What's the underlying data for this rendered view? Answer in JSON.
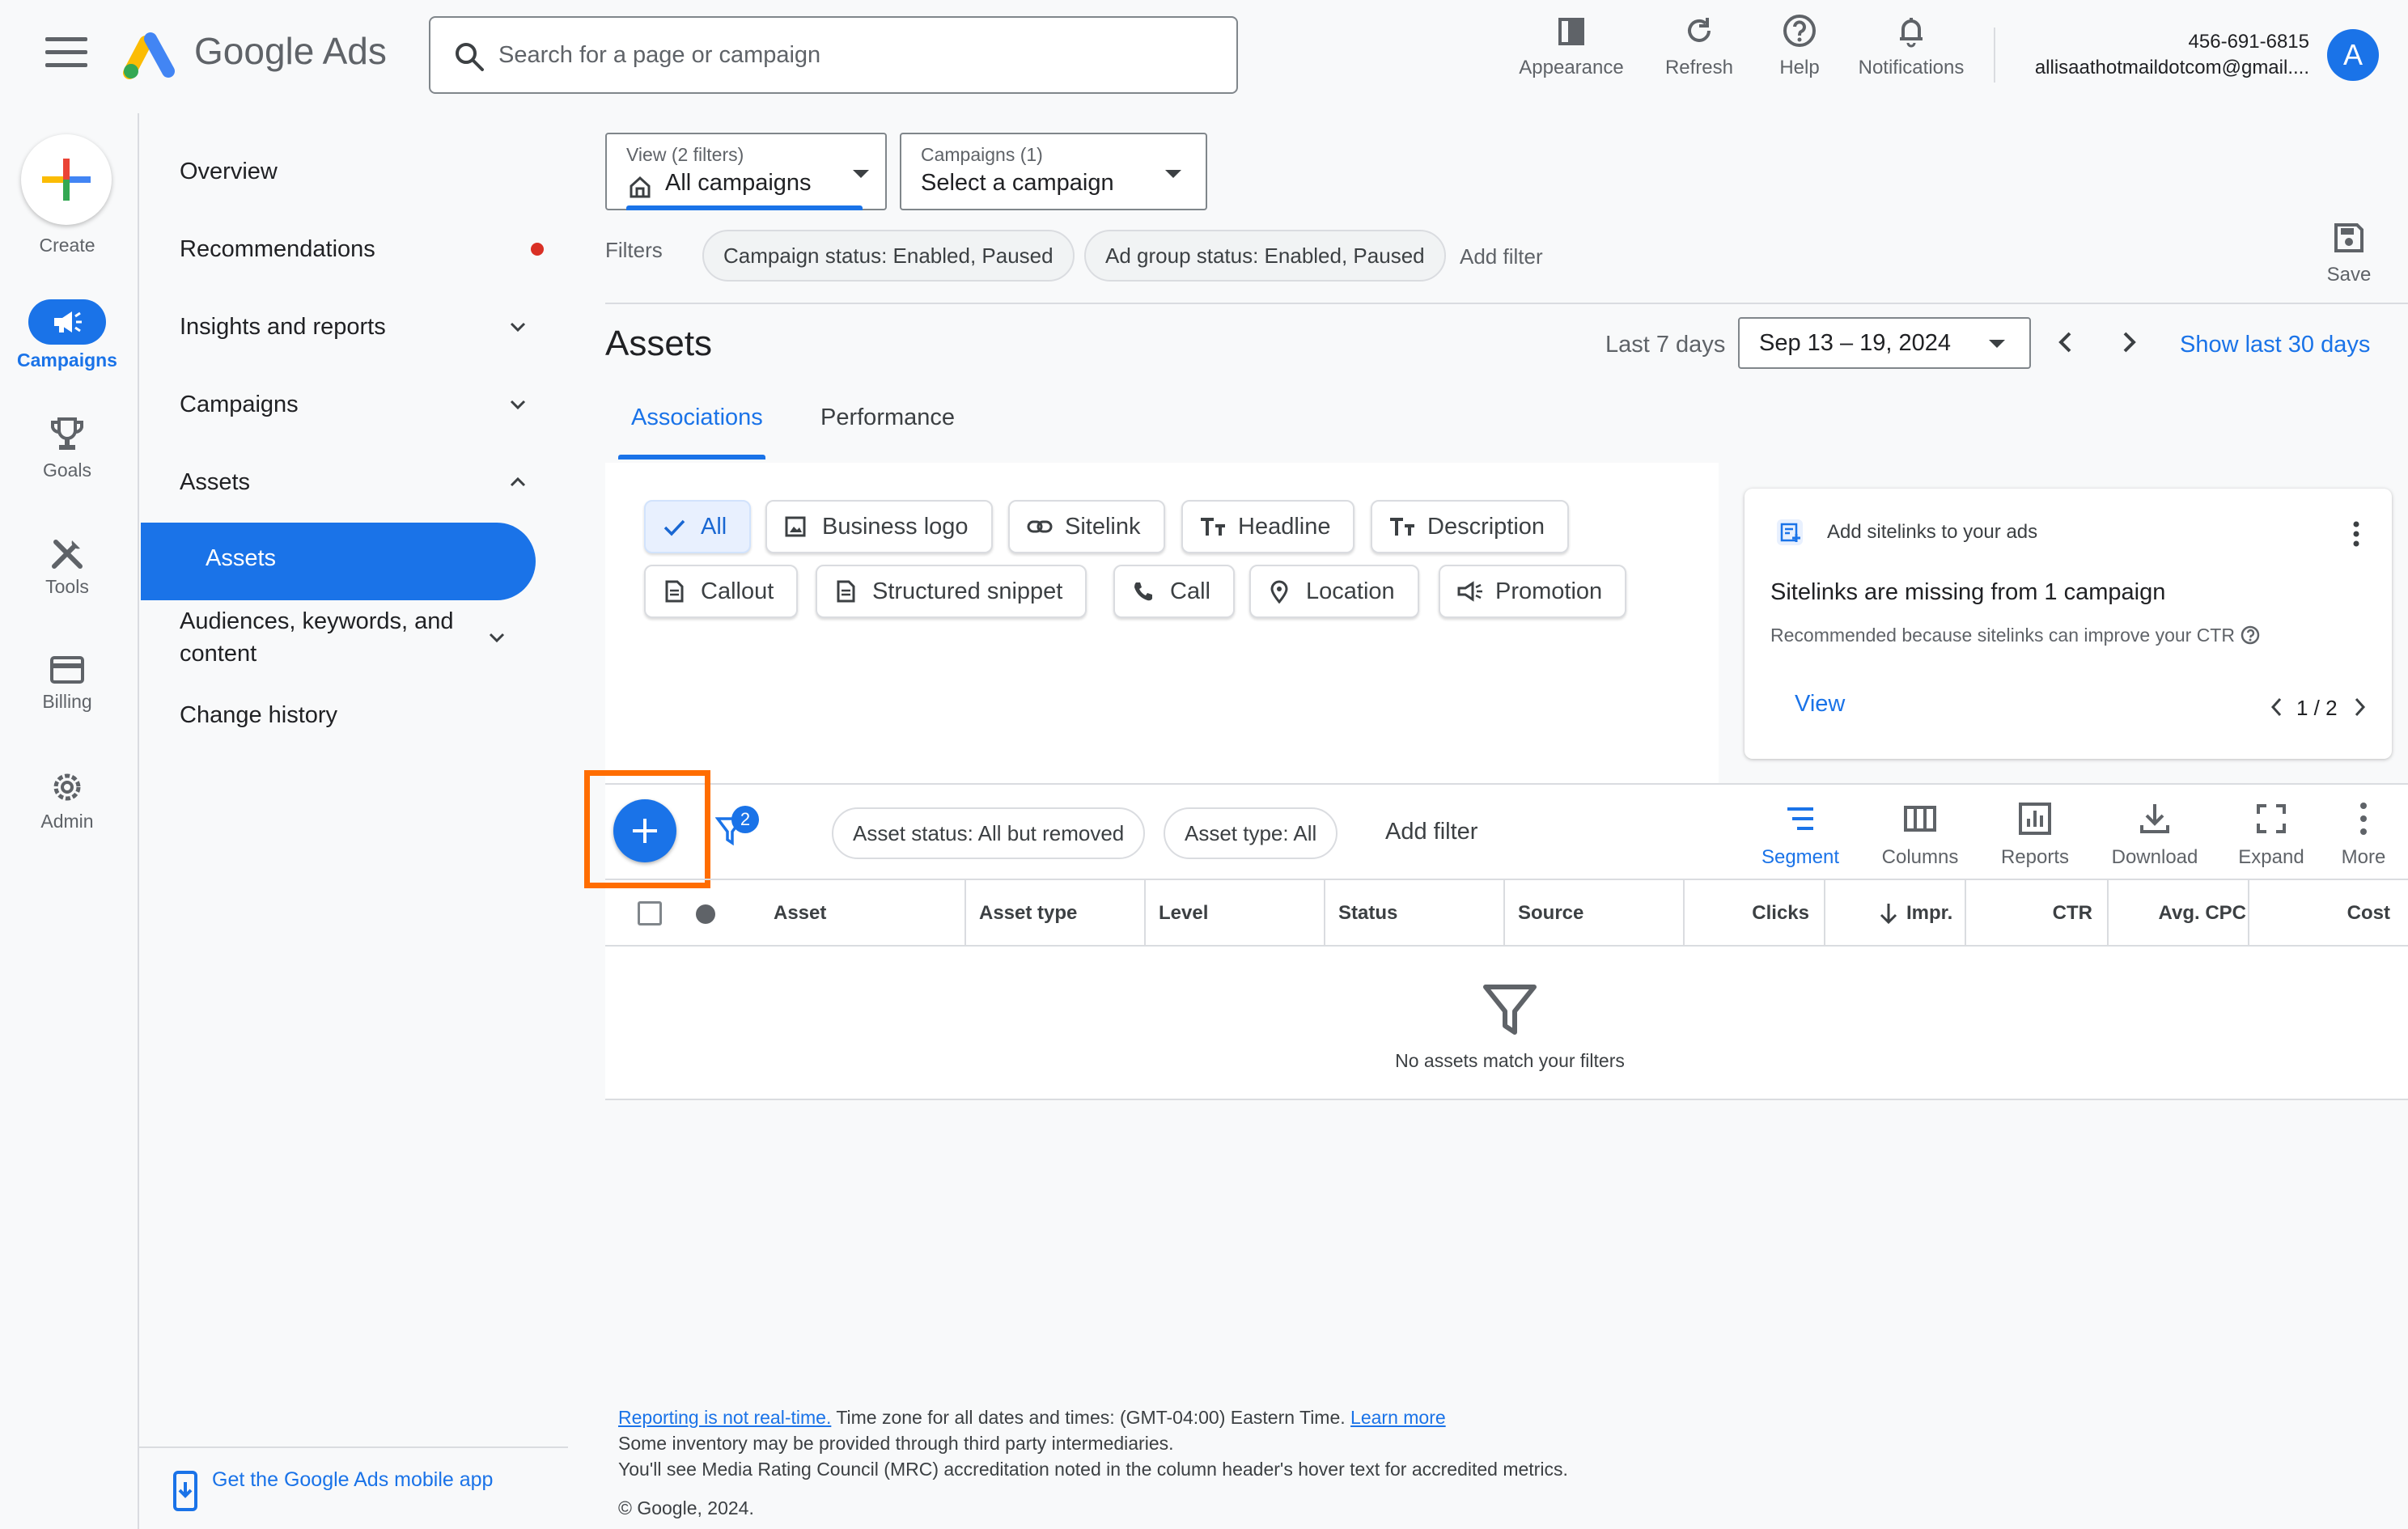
{
  "header": {
    "brand": "Google Ads",
    "search_placeholder": "Search for a page or campaign",
    "actions": [
      "Appearance",
      "Refresh",
      "Help",
      "Notifications"
    ],
    "account_id": "456-691-6815",
    "account_email": "allisaathotmaildotcom@gmail....",
    "avatar_letter": "A"
  },
  "rail": {
    "create": "Create",
    "items": [
      "Campaigns",
      "Goals",
      "Tools",
      "Billing",
      "Admin"
    ]
  },
  "nav": {
    "overview": "Overview",
    "recommendations": "Recommendations",
    "insights": "Insights and reports",
    "campaigns": "Campaigns",
    "assets": "Assets",
    "assets_sub": "Assets",
    "audiences": "Audiences, keywords, and content",
    "change_history": "Change history",
    "mobile_app": "Get the Google Ads mobile app"
  },
  "filters_bar": {
    "view_small": "View (2 filters)",
    "view_value": "All campaigns",
    "campaigns_small": "Campaigns (1)",
    "campaigns_value": "Select a campaign",
    "filters_label": "Filters",
    "chip1": "Campaign status: Enabled, Paused",
    "chip2": "Ad group status: Enabled, Paused",
    "add_filter": "Add filter",
    "save": "Save"
  },
  "page": {
    "title": "Assets",
    "date_label": "Last 7 days",
    "date_range": "Sep 13 – 19, 2024",
    "show_last": "Show last 30 days",
    "tabs": [
      "Associations",
      "Performance"
    ]
  },
  "asset_types": [
    "All",
    "Business logo",
    "Sitelink",
    "Headline",
    "Description",
    "Callout",
    "Structured snippet",
    "Call",
    "Location",
    "Promotion"
  ],
  "recommendation_card": {
    "header": "Add sitelinks to your ads",
    "title": "Sitelinks are missing from 1 campaign",
    "body": "Recommended because sitelinks can improve your CTR",
    "action": "View",
    "pager": "1 / 2"
  },
  "table_toolbar": {
    "filter_count": "2",
    "chip_status": "Asset status: All but removed",
    "chip_type": "Asset type: All",
    "add_filter": "Add filter",
    "tools": [
      "Segment",
      "Columns",
      "Reports",
      "Download",
      "Expand",
      "More"
    ]
  },
  "table": {
    "columns": [
      "Asset",
      "Asset type",
      "Level",
      "Status",
      "Source",
      "Clicks",
      "Impr.",
      "CTR",
      "Avg. CPC",
      "Cost"
    ],
    "empty_message": "No assets match your filters"
  },
  "footer": {
    "reporting_link": "Reporting is not real-time.",
    "tz": " Time zone for all dates and times: (GMT-04:00) Eastern Time. ",
    "learn_more": "Learn more",
    "line2": "Some inventory may be provided through third party intermediaries.",
    "line3": "You'll see Media Rating Council (MRC) accreditation noted in the column header's hover text for accredited metrics.",
    "copyright": "© Google, 2024."
  },
  "colors": {
    "accent": "#1a73e8",
    "highlight": "#ff6d00",
    "red_dot": "#d93025"
  }
}
